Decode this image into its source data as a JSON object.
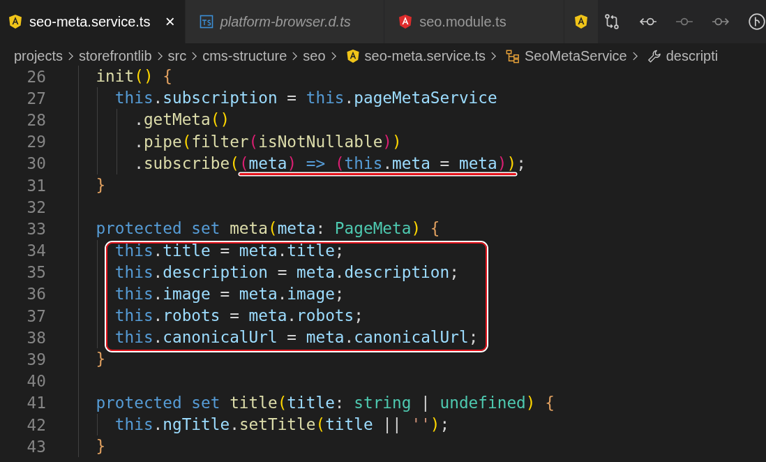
{
  "tabs": [
    {
      "label": "seo-meta.service.ts",
      "kind": "angular",
      "selected": true,
      "italic": false,
      "close": "×"
    },
    {
      "label": "platform-browser.d.ts",
      "kind": "ts",
      "selected": false,
      "italic": true
    },
    {
      "label": "seo.module.ts",
      "kind": "angular-red",
      "selected": false,
      "italic": false
    },
    {
      "kind": "angular",
      "selected": false
    }
  ],
  "breadcrumbs": [
    {
      "label": "projects",
      "kind": "folder"
    },
    {
      "label": "storefrontlib",
      "kind": "folder"
    },
    {
      "label": "src",
      "kind": "folder"
    },
    {
      "label": "cms-structure",
      "kind": "folder"
    },
    {
      "label": "seo",
      "kind": "folder"
    },
    {
      "label": "seo-meta.service.ts",
      "kind": "angular"
    },
    {
      "label": "SeoMetaService",
      "kind": "class"
    },
    {
      "label": "descripti",
      "kind": "wrench"
    }
  ],
  "blocks": [
    {
      "kind": "plain",
      "lines": [
        {
          "number": "26",
          "tokens": [
            {
              "kind": "fn",
              "t": "  init"
            },
            {
              "kind": "b1",
              "t": "()"
            },
            {
              "kind": "brace",
              "t": " {"
            }
          ]
        },
        {
          "number": "27",
          "tokens": [
            {
              "kind": "kw",
              "t": "    this"
            },
            {
              "kind": "op",
              "t": "."
            },
            {
              "kind": "prop",
              "t": "subscription"
            },
            {
              "kind": "op",
              "t": " = "
            },
            {
              "kind": "kw",
              "t": "this"
            },
            {
              "kind": "op",
              "t": "."
            },
            {
              "kind": "prop",
              "t": "pageMetaService"
            }
          ]
        },
        {
          "number": "28",
          "tokens": [
            {
              "kind": "op",
              "t": "      ."
            },
            {
              "kind": "fn",
              "t": "getMeta"
            },
            {
              "kind": "b1",
              "t": "()"
            }
          ]
        },
        {
          "number": "29",
          "tokens": [
            {
              "kind": "op",
              "t": "      ."
            },
            {
              "kind": "fn",
              "t": "pipe"
            },
            {
              "kind": "b1",
              "t": "("
            },
            {
              "kind": "fn",
              "t": "filter"
            },
            {
              "kind": "b2",
              "t": "("
            },
            {
              "kind": "fn",
              "t": "isNotNullable"
            },
            {
              "kind": "b2",
              "t": ")"
            },
            {
              "kind": "b1",
              "t": ")"
            }
          ]
        },
        {
          "number": "30",
          "tokens": [
            {
              "kind": "op",
              "t": "      ."
            },
            {
              "kind": "fn",
              "t": "subscribe"
            },
            {
              "kind": "b1",
              "t": "("
            }
          ],
          "underlined_tokens": [
            {
              "kind": "b2",
              "t": "("
            },
            {
              "kind": "prop",
              "t": "meta"
            },
            {
              "kind": "b2",
              "t": ")"
            },
            {
              "kind": "kw",
              "t": " => "
            },
            {
              "kind": "b2",
              "t": "("
            },
            {
              "kind": "kw",
              "t": "this"
            },
            {
              "kind": "op",
              "t": "."
            },
            {
              "kind": "prop",
              "t": "meta"
            },
            {
              "kind": "op",
              "t": " = "
            },
            {
              "kind": "prop",
              "t": "meta"
            },
            {
              "kind": "b2",
              "t": ")"
            }
          ],
          "after_tokens": [
            {
              "kind": "b1",
              "t": ")"
            },
            {
              "kind": "op",
              "t": ";"
            }
          ]
        },
        {
          "number": "31",
          "tokens": [
            {
              "kind": "brace",
              "t": "  }"
            }
          ]
        },
        {
          "number": "32"
        },
        {
          "number": "33",
          "tokens": [
            {
              "kind": "kw",
              "t": "  protected set "
            },
            {
              "kind": "fn",
              "t": "meta"
            },
            {
              "kind": "b1",
              "t": "("
            },
            {
              "kind": "prop",
              "t": "meta"
            },
            {
              "kind": "op",
              "t": ": "
            },
            {
              "kind": "type",
              "t": "PageMeta"
            },
            {
              "kind": "b1",
              "t": ")"
            },
            {
              "kind": "brace",
              "t": " {"
            }
          ]
        }
      ]
    },
    {
      "kind": "boxed",
      "lines": [
        {
          "number": "34",
          "tokens": [
            {
              "kind": "kw",
              "t": "    this"
            },
            {
              "kind": "op",
              "t": "."
            },
            {
              "kind": "prop",
              "t": "title"
            },
            {
              "kind": "op",
              "t": " = "
            },
            {
              "kind": "prop",
              "t": "meta"
            },
            {
              "kind": "op",
              "t": "."
            },
            {
              "kind": "prop",
              "t": "title"
            },
            {
              "kind": "op",
              "t": ";"
            }
          ]
        },
        {
          "number": "35",
          "tokens": [
            {
              "kind": "kw",
              "t": "    this"
            },
            {
              "kind": "op",
              "t": "."
            },
            {
              "kind": "prop",
              "t": "description"
            },
            {
              "kind": "op",
              "t": " = "
            },
            {
              "kind": "prop",
              "t": "meta"
            },
            {
              "kind": "op",
              "t": "."
            },
            {
              "kind": "prop",
              "t": "description"
            },
            {
              "kind": "op",
              "t": ";"
            }
          ]
        },
        {
          "number": "36",
          "tokens": [
            {
              "kind": "kw",
              "t": "    this"
            },
            {
              "kind": "op",
              "t": "."
            },
            {
              "kind": "prop",
              "t": "image"
            },
            {
              "kind": "op",
              "t": " = "
            },
            {
              "kind": "prop",
              "t": "meta"
            },
            {
              "kind": "op",
              "t": "."
            },
            {
              "kind": "prop",
              "t": "image"
            },
            {
              "kind": "op",
              "t": ";"
            }
          ]
        },
        {
          "number": "37",
          "tokens": [
            {
              "kind": "kw",
              "t": "    this"
            },
            {
              "kind": "op",
              "t": "."
            },
            {
              "kind": "prop",
              "t": "robots"
            },
            {
              "kind": "op",
              "t": " = "
            },
            {
              "kind": "prop",
              "t": "meta"
            },
            {
              "kind": "op",
              "t": "."
            },
            {
              "kind": "prop",
              "t": "robots"
            },
            {
              "kind": "op",
              "t": ";"
            }
          ]
        },
        {
          "number": "38",
          "tokens": [
            {
              "kind": "kw",
              "t": "    this"
            },
            {
              "kind": "op",
              "t": "."
            },
            {
              "kind": "prop",
              "t": "canonicalUrl"
            },
            {
              "kind": "op",
              "t": " = "
            },
            {
              "kind": "prop",
              "t": "meta"
            },
            {
              "kind": "op",
              "t": "."
            },
            {
              "kind": "prop",
              "t": "canonicalUrl"
            },
            {
              "kind": "op",
              "t": ";"
            }
          ]
        }
      ]
    },
    {
      "kind": "plain",
      "lines": [
        {
          "number": "39",
          "tokens": [
            {
              "kind": "brace",
              "t": "  }"
            }
          ]
        },
        {
          "number": "40"
        },
        {
          "number": "41",
          "tokens": [
            {
              "kind": "kw",
              "t": "  protected set "
            },
            {
              "kind": "fn",
              "t": "title"
            },
            {
              "kind": "b1",
              "t": "("
            },
            {
              "kind": "prop",
              "t": "title"
            },
            {
              "kind": "op",
              "t": ": "
            },
            {
              "kind": "type",
              "t": "string"
            },
            {
              "kind": "op",
              "t": " | "
            },
            {
              "kind": "type",
              "t": "undefined"
            },
            {
              "kind": "b1",
              "t": ")"
            },
            {
              "kind": "brace",
              "t": " {"
            }
          ]
        },
        {
          "number": "42",
          "tokens": [
            {
              "kind": "kw",
              "t": "    this"
            },
            {
              "kind": "op",
              "t": "."
            },
            {
              "kind": "prop",
              "t": "ngTitle"
            },
            {
              "kind": "op",
              "t": "."
            },
            {
              "kind": "fn",
              "t": "setTitle"
            },
            {
              "kind": "b1",
              "t": "("
            },
            {
              "kind": "prop",
              "t": "title"
            },
            {
              "kind": "op",
              "t": " || "
            },
            {
              "kind": "str",
              "t": "''"
            },
            {
              "kind": "b1",
              "t": ")"
            },
            {
              "kind": "op",
              "t": ";"
            }
          ]
        },
        {
          "number": "43",
          "tokens": [
            {
              "kind": "brace",
              "t": "  }"
            }
          ]
        }
      ]
    }
  ]
}
